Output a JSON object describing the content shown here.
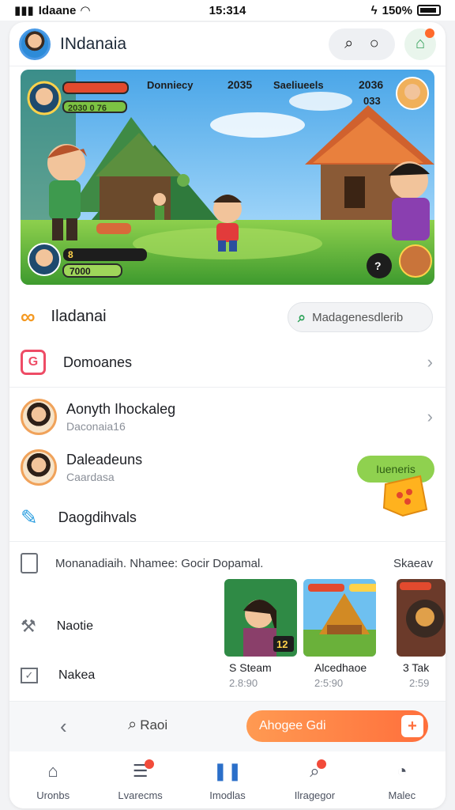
{
  "status": {
    "carrier": "Idaane",
    "time": "15:314",
    "battery": "150%"
  },
  "header": {
    "title": "INdanaia"
  },
  "banner": {
    "top_left_score": "2030 0 76",
    "hud_left": "Donniecy",
    "hud_score": "2035",
    "hud_right": "Saeliueels",
    "right_top": "2036",
    "right_sub": "033",
    "bottom_score": "7000",
    "bottom_count": "8"
  },
  "section": {
    "title": "Iladanai",
    "search_placeholder": "Madagenesdlerib"
  },
  "rows": [
    {
      "title": "Domoanes"
    },
    {
      "title": "Aonyth Ihockaleg",
      "sub": "Daconaia16"
    },
    {
      "title": "Daleadeuns",
      "sub": "Caardasa"
    },
    {
      "title": "Daogdihvals"
    }
  ],
  "green_pill": "Iueneris",
  "strip": {
    "text": "Monanadiaih. Nhamee: Gocir Dopamal.",
    "right": "Skaeav"
  },
  "side_items": [
    {
      "label": "Naotie"
    },
    {
      "label": "Nakea"
    }
  ],
  "thumbs": [
    {
      "title": "S Steam",
      "sub": "2.8:90"
    },
    {
      "title": "Alcedhaoe",
      "sub": "2:5:90"
    },
    {
      "title": "3 Tak",
      "sub": "2:59"
    }
  ],
  "action_bar": {
    "search_label": "Raoi",
    "cta_label": "Ahogee Gdi"
  },
  "nav": [
    {
      "label": "Uronbs"
    },
    {
      "label": "Lvarecms"
    },
    {
      "label": "Imodlas"
    },
    {
      "label": "Ilragegor"
    },
    {
      "label": "Malec"
    }
  ],
  "colors": {
    "accent": "#ff6f3c",
    "green": "#8fd14f",
    "nav_active": "#2b6fc9"
  }
}
